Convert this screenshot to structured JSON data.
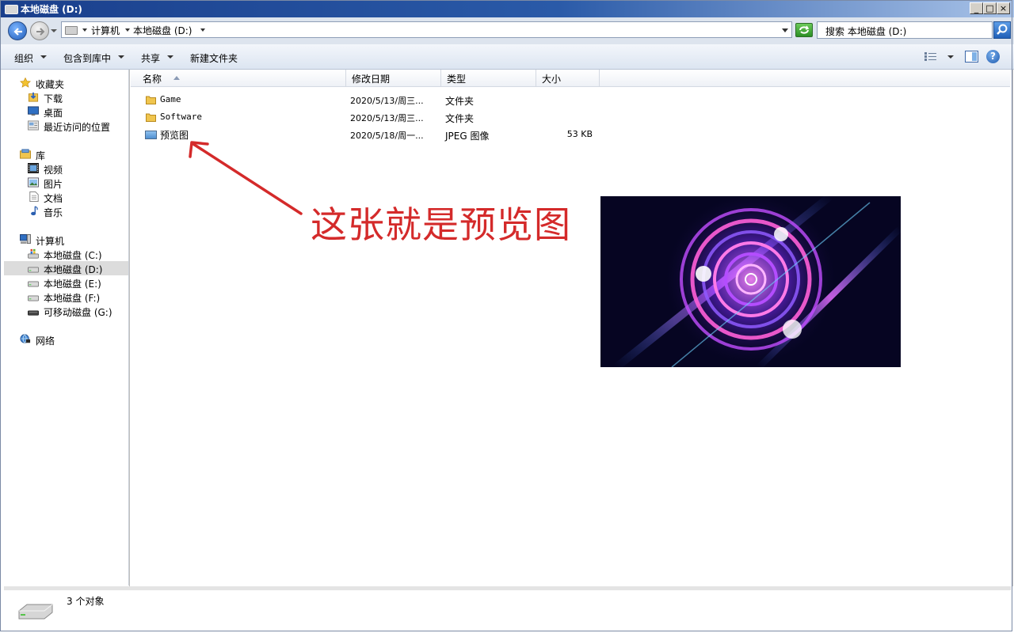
{
  "window": {
    "title": "本地磁盘 (D:)",
    "minimize_glyph": "_",
    "maximize_glyph": "□",
    "close_glyph": "×"
  },
  "address_bar": {
    "breadcrumbs": [
      "计算机",
      "本地磁盘 (D:)"
    ],
    "search_placeholder": "搜索 本地磁盘 (D:)"
  },
  "toolbar": {
    "organize": "组织",
    "include_in_library": "包含到库中",
    "share": "共享",
    "new_folder": "新建文件夹",
    "help_glyph": "?"
  },
  "sidebar": {
    "favorites": {
      "label": "收藏夹",
      "items": [
        {
          "label": "下载",
          "icon": "download-folder-icon"
        },
        {
          "label": "桌面",
          "icon": "desktop-icon"
        },
        {
          "label": "最近访问的位置",
          "icon": "recent-places-icon"
        }
      ]
    },
    "libraries": {
      "label": "库",
      "items": [
        {
          "label": "视频",
          "icon": "video-icon"
        },
        {
          "label": "图片",
          "icon": "pictures-icon"
        },
        {
          "label": "文档",
          "icon": "document-icon"
        },
        {
          "label": "音乐",
          "icon": "music-icon"
        }
      ]
    },
    "computer": {
      "label": "计算机",
      "items": [
        {
          "label": "本地磁盘 (C:)",
          "icon": "system-drive-icon"
        },
        {
          "label": "本地磁盘 (D:)",
          "icon": "drive-icon",
          "selected": true
        },
        {
          "label": "本地磁盘 (E:)",
          "icon": "drive-icon"
        },
        {
          "label": "本地磁盘 (F:)",
          "icon": "drive-icon"
        },
        {
          "label": "可移动磁盘 (G:)",
          "icon": "removable-drive-icon"
        }
      ]
    },
    "network": {
      "label": "网络"
    }
  },
  "file_list": {
    "columns": [
      "名称",
      "修改日期",
      "类型",
      "大小"
    ],
    "rows": [
      {
        "name": "Game",
        "date": "2020/5/13/周三...",
        "type": "文件夹",
        "size": "",
        "icon": "folder-icon"
      },
      {
        "name": "Software",
        "date": "2020/5/13/周三...",
        "type": "文件夹",
        "size": "",
        "icon": "folder-icon"
      },
      {
        "name": "预览图",
        "date": "2020/5/18/周一...",
        "type": "JPEG 图像",
        "size": "53 KB",
        "icon": "image-file-icon"
      }
    ]
  },
  "annotation": {
    "text": "这张就是预览图",
    "color": "#d42a2a"
  },
  "status": {
    "item_count": "3 个对象"
  },
  "colors": {
    "titlebar": "#1a3f8c",
    "selection": "#dcdcdc",
    "annotation_red": "#d42a2a"
  }
}
